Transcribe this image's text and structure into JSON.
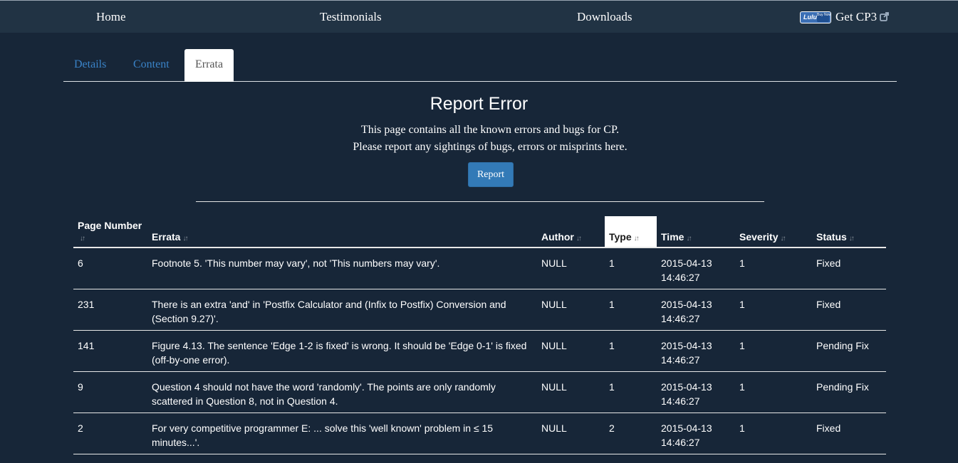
{
  "nav": {
    "home": "Home",
    "testimonials": "Testimonials",
    "downloads": "Downloads",
    "get_cp3": "Get CP3",
    "lulu_badge": "Lulu",
    "lulu_buy": "Buy Now"
  },
  "tabs": [
    {
      "label": "Details",
      "active": false
    },
    {
      "label": "Content",
      "active": false
    },
    {
      "label": "Errata",
      "active": true
    }
  ],
  "section": {
    "title": "Report Error",
    "line1": "This page contains all the known errors and bugs for CP.",
    "line2": "Please report any sightings of bugs, errors or misprints here.",
    "report_button": "Report"
  },
  "table": {
    "headers": [
      "Page Number",
      "Errata",
      "Author",
      "Type",
      "Time",
      "Severity",
      "Status"
    ],
    "sort_icon": "sort-icon",
    "rows": [
      {
        "page": "6",
        "errata": "Footnote 5. 'This number may vary', not 'This numbers may vary'.",
        "author": "NULL",
        "type": "1",
        "time_date": "2015-04-13",
        "time_clock": "14:46:27",
        "severity": "1",
        "status": "Fixed"
      },
      {
        "page": "231",
        "errata": "There is an extra 'and' in 'Postfix Calculator and (Infix to Postfix) Conversion and (Section 9.27)'.",
        "author": "NULL",
        "type": "1",
        "time_date": "2015-04-13",
        "time_clock": "14:46:27",
        "severity": "1",
        "status": "Fixed"
      },
      {
        "page": "141",
        "errata": "Figure 4.13. The sentence 'Edge 1-2 is fixed' is wrong. It should be 'Edge 0-1' is fixed (off-by-one error).",
        "author": "NULL",
        "type": "1",
        "time_date": "2015-04-13",
        "time_clock": "14:46:27",
        "severity": "1",
        "status": "Pending Fix"
      },
      {
        "page": "9",
        "errata": "Question 4 should not have the word 'randomly'. The points are only randomly scattered in Question 8, not in Question 4.",
        "author": "NULL",
        "type": "1",
        "time_date": "2015-04-13",
        "time_clock": "14:46:27",
        "severity": "1",
        "status": "Pending Fix"
      },
      {
        "page": "2",
        "errata": "For very competitive programmer E: ... solve this 'well known' problem in ≤ 15 minutes...'.",
        "author": "NULL",
        "type": "2",
        "time_date": "2015-04-13",
        "time_clock": "14:46:27",
        "severity": "1",
        "status": "Fixed"
      }
    ]
  },
  "colors": {
    "background": "#172638",
    "navbar": "#213344",
    "link": "#3a83c8",
    "button": "#337ab7"
  }
}
